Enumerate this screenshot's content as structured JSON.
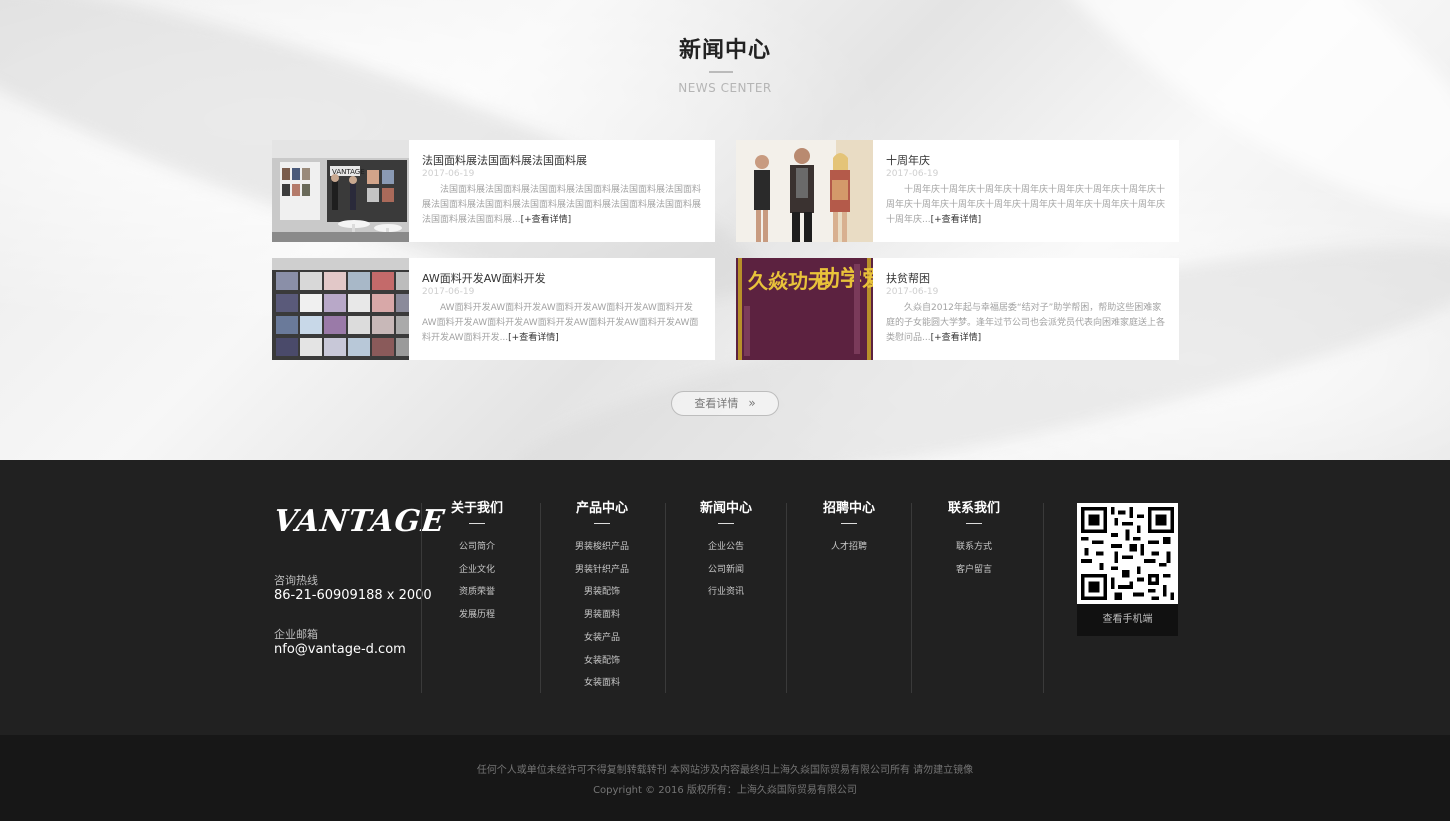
{
  "news_section": {
    "title": "新闻中心",
    "subtitle": "NEWS CENTER",
    "more_button": "查看详情",
    "more_button_arrow": "»",
    "items": [
      {
        "title": "法国面料展法国面料展法国面料展",
        "date": "2017-06-19",
        "excerpt": "法国面料展法国面料展法国面料展法国面料展法国面料展法国面料展法国面料展法国面料展法国面料展法国面料展法国面料展法国面料展法国面料展法国面料展...",
        "more": "[+查看详情]"
      },
      {
        "title": "十周年庆",
        "date": "2017-06-19",
        "excerpt": "十周年庆十周年庆十周年庆十周年庆十周年庆十周年庆十周年庆十周年庆十周年庆十周年庆十周年庆十周年庆十周年庆十周年庆十周年庆十周年庆...",
        "more": "[+查看详情]"
      },
      {
        "title": "AW面料开发AW面料开发",
        "date": "2017-06-19",
        "excerpt": "AW面料开发AW面料开发AW面料开发AW面料开发AW面料开发AW面料开发AW面料开发AW面料开发AW面料开发AW面料开发AW面料开发AW面料开发...",
        "more": "[+查看详情]"
      },
      {
        "title": "扶贫帮困",
        "date": "2017-06-19",
        "excerpt": "久焱自2012年起与幸福居委“结对子”助学帮困，帮助这些困难家庭的子女能圆大学梦。逢年过节公司也会派党员代表向困难家庭送上各类慰问品...",
        "more": "[+查看详情]",
        "banner_text_1": "助学爱无",
        "banner_text_2": "久焱功无"
      }
    ]
  },
  "footer": {
    "logo": "VANTAGE",
    "hotline_label": "咨询热线",
    "hotline": "86-21-60909188 x 2000",
    "email_label": "企业邮箱",
    "email": "nfo@vantage-d.com",
    "columns": [
      {
        "title": "关于我们",
        "links": [
          "公司简介",
          "企业文化",
          "资质荣誉",
          "发展历程"
        ]
      },
      {
        "title": "产品中心",
        "links": [
          "男装梭织产品",
          "男装针织产品",
          "男装配饰",
          "男装面料",
          "女装产品",
          "女装配饰",
          "女装面料"
        ]
      },
      {
        "title": "新闻中心",
        "links": [
          "企业公告",
          "公司新闻",
          "行业资讯"
        ]
      },
      {
        "title": "招聘中心",
        "links": [
          "人才招聘"
        ]
      },
      {
        "title": "联系我们",
        "links": [
          "联系方式",
          "客户留言"
        ]
      }
    ],
    "qr_caption": "查看手机端"
  },
  "copyright": {
    "line1": "任何个人或单位未经许可不得复制转载转刊 本网站涉及内容最终归上海久焱国际贸易有限公司所有 请勿建立镜像",
    "line2": "Copyright © 2016 版权所有：上海久焱国际贸易有限公司"
  }
}
